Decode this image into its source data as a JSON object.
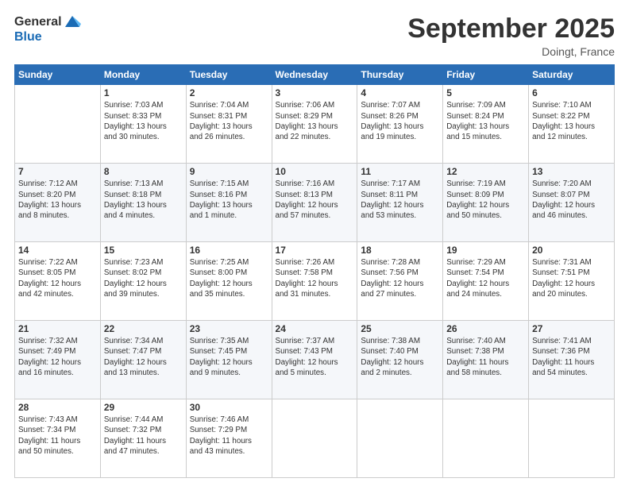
{
  "header": {
    "logo_general": "General",
    "logo_blue": "Blue",
    "month_title": "September 2025",
    "location": "Doingt, France"
  },
  "days_of_week": [
    "Sunday",
    "Monday",
    "Tuesday",
    "Wednesday",
    "Thursday",
    "Friday",
    "Saturday"
  ],
  "weeks": [
    [
      {
        "day": "",
        "info": ""
      },
      {
        "day": "1",
        "info": "Sunrise: 7:03 AM\nSunset: 8:33 PM\nDaylight: 13 hours\nand 30 minutes."
      },
      {
        "day": "2",
        "info": "Sunrise: 7:04 AM\nSunset: 8:31 PM\nDaylight: 13 hours\nand 26 minutes."
      },
      {
        "day": "3",
        "info": "Sunrise: 7:06 AM\nSunset: 8:29 PM\nDaylight: 13 hours\nand 22 minutes."
      },
      {
        "day": "4",
        "info": "Sunrise: 7:07 AM\nSunset: 8:26 PM\nDaylight: 13 hours\nand 19 minutes."
      },
      {
        "day": "5",
        "info": "Sunrise: 7:09 AM\nSunset: 8:24 PM\nDaylight: 13 hours\nand 15 minutes."
      },
      {
        "day": "6",
        "info": "Sunrise: 7:10 AM\nSunset: 8:22 PM\nDaylight: 13 hours\nand 12 minutes."
      }
    ],
    [
      {
        "day": "7",
        "info": "Sunrise: 7:12 AM\nSunset: 8:20 PM\nDaylight: 13 hours\nand 8 minutes."
      },
      {
        "day": "8",
        "info": "Sunrise: 7:13 AM\nSunset: 8:18 PM\nDaylight: 13 hours\nand 4 minutes."
      },
      {
        "day": "9",
        "info": "Sunrise: 7:15 AM\nSunset: 8:16 PM\nDaylight: 13 hours\nand 1 minute."
      },
      {
        "day": "10",
        "info": "Sunrise: 7:16 AM\nSunset: 8:13 PM\nDaylight: 12 hours\nand 57 minutes."
      },
      {
        "day": "11",
        "info": "Sunrise: 7:17 AM\nSunset: 8:11 PM\nDaylight: 12 hours\nand 53 minutes."
      },
      {
        "day": "12",
        "info": "Sunrise: 7:19 AM\nSunset: 8:09 PM\nDaylight: 12 hours\nand 50 minutes."
      },
      {
        "day": "13",
        "info": "Sunrise: 7:20 AM\nSunset: 8:07 PM\nDaylight: 12 hours\nand 46 minutes."
      }
    ],
    [
      {
        "day": "14",
        "info": "Sunrise: 7:22 AM\nSunset: 8:05 PM\nDaylight: 12 hours\nand 42 minutes."
      },
      {
        "day": "15",
        "info": "Sunrise: 7:23 AM\nSunset: 8:02 PM\nDaylight: 12 hours\nand 39 minutes."
      },
      {
        "day": "16",
        "info": "Sunrise: 7:25 AM\nSunset: 8:00 PM\nDaylight: 12 hours\nand 35 minutes."
      },
      {
        "day": "17",
        "info": "Sunrise: 7:26 AM\nSunset: 7:58 PM\nDaylight: 12 hours\nand 31 minutes."
      },
      {
        "day": "18",
        "info": "Sunrise: 7:28 AM\nSunset: 7:56 PM\nDaylight: 12 hours\nand 27 minutes."
      },
      {
        "day": "19",
        "info": "Sunrise: 7:29 AM\nSunset: 7:54 PM\nDaylight: 12 hours\nand 24 minutes."
      },
      {
        "day": "20",
        "info": "Sunrise: 7:31 AM\nSunset: 7:51 PM\nDaylight: 12 hours\nand 20 minutes."
      }
    ],
    [
      {
        "day": "21",
        "info": "Sunrise: 7:32 AM\nSunset: 7:49 PM\nDaylight: 12 hours\nand 16 minutes."
      },
      {
        "day": "22",
        "info": "Sunrise: 7:34 AM\nSunset: 7:47 PM\nDaylight: 12 hours\nand 13 minutes."
      },
      {
        "day": "23",
        "info": "Sunrise: 7:35 AM\nSunset: 7:45 PM\nDaylight: 12 hours\nand 9 minutes."
      },
      {
        "day": "24",
        "info": "Sunrise: 7:37 AM\nSunset: 7:43 PM\nDaylight: 12 hours\nand 5 minutes."
      },
      {
        "day": "25",
        "info": "Sunrise: 7:38 AM\nSunset: 7:40 PM\nDaylight: 12 hours\nand 2 minutes."
      },
      {
        "day": "26",
        "info": "Sunrise: 7:40 AM\nSunset: 7:38 PM\nDaylight: 11 hours\nand 58 minutes."
      },
      {
        "day": "27",
        "info": "Sunrise: 7:41 AM\nSunset: 7:36 PM\nDaylight: 11 hours\nand 54 minutes."
      }
    ],
    [
      {
        "day": "28",
        "info": "Sunrise: 7:43 AM\nSunset: 7:34 PM\nDaylight: 11 hours\nand 50 minutes."
      },
      {
        "day": "29",
        "info": "Sunrise: 7:44 AM\nSunset: 7:32 PM\nDaylight: 11 hours\nand 47 minutes."
      },
      {
        "day": "30",
        "info": "Sunrise: 7:46 AM\nSunset: 7:29 PM\nDaylight: 11 hours\nand 43 minutes."
      },
      {
        "day": "",
        "info": ""
      },
      {
        "day": "",
        "info": ""
      },
      {
        "day": "",
        "info": ""
      },
      {
        "day": "",
        "info": ""
      }
    ]
  ]
}
